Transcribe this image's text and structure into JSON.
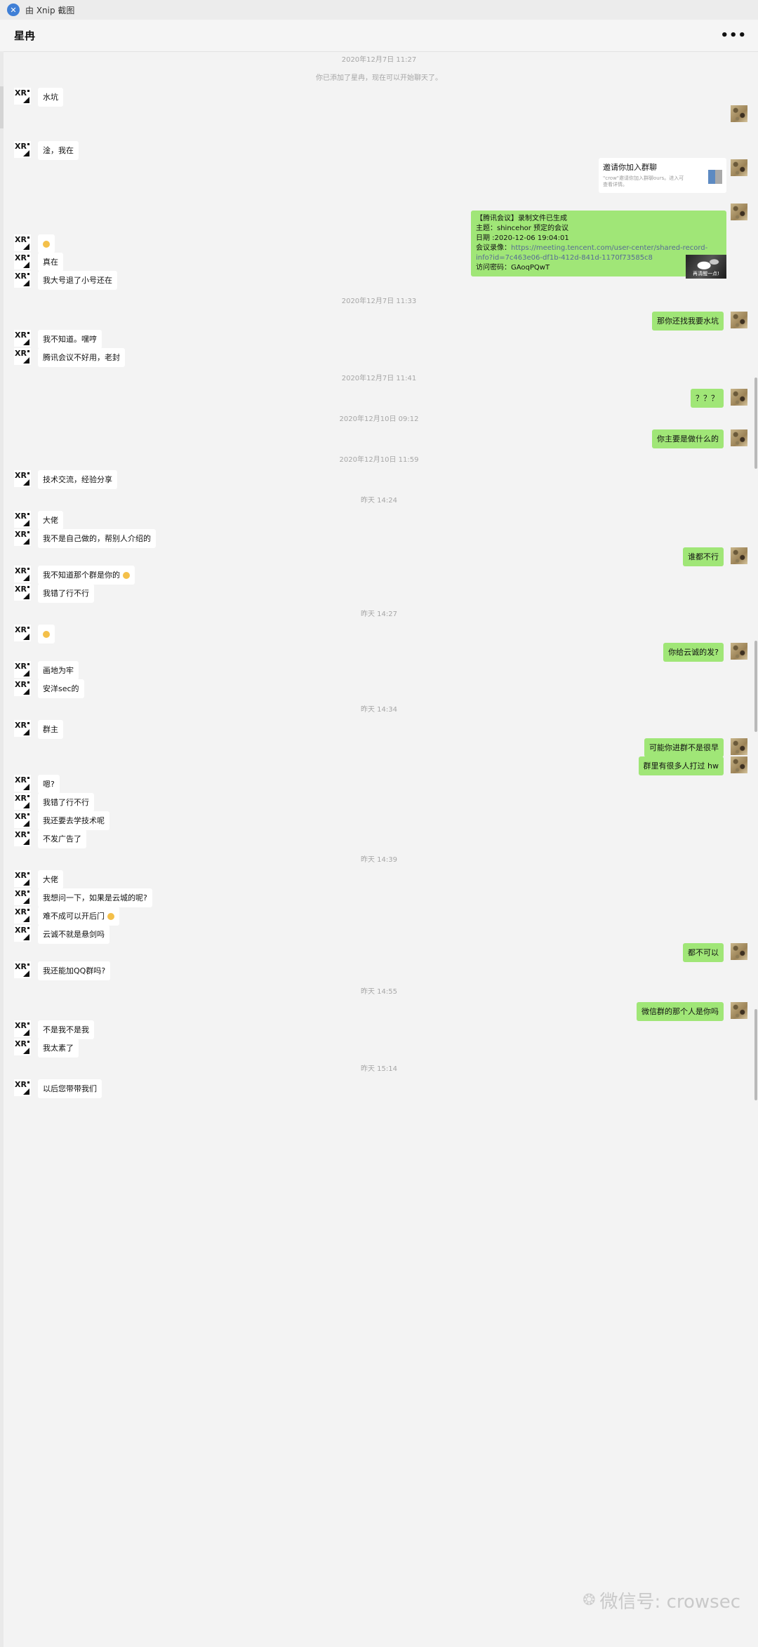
{
  "window": {
    "title": "由 Xnip 截图"
  },
  "chat": {
    "name": "星冉",
    "system_notice": "你已添加了星冉，现在可以开始聊天了。",
    "timestamps": [
      "2020年12月7日 11:27",
      "2020年12月7日 11:33",
      "2020年12月7日 11:41",
      "2020年12月10日 09:12",
      "2020年12月10日 11:59",
      "昨天 14:24",
      "昨天 14:27",
      "昨天 14:34",
      "昨天 14:39",
      "昨天 14:55",
      "昨天 15:14"
    ],
    "contact_avatar_text": "XR",
    "invite_card": {
      "title": "邀请你加入群聊",
      "desc": "\"crow\"邀请你加入群聊ours。进入可查看详情。"
    },
    "meeting": {
      "line1": "【腾讯会议】录制文件已生成",
      "line2": "主题：shincehor 预定的会议",
      "line3": "日期 :2020-12-06 19:04:01",
      "line4_label": "会议录像：",
      "line4_link": "https://meeting.tencent.com/user-center/shared-record-info?id=7c463e06-df1b-412d-841d-1170f73585c8",
      "line5": "访问密码：GAoqPQwT"
    },
    "photo_caption": "再清醒一点!",
    "messages": {
      "m1": "水坑",
      "m2": "淦，我在",
      "m3": "真在",
      "m4": "我大号退了小号还在",
      "m5": "那你还找我要水坑",
      "m6": "我不知道。嘿哼",
      "m7": "腾讯会议不好用，老封",
      "m8": "？？？",
      "m9": "你主要是做什么的",
      "m10": "技术交流，经验分享",
      "m11": "大佬",
      "m12": "我不是自己做的，帮别人介绍的",
      "m13": "谁都不行",
      "m14": "我不知道那个群是你的",
      "m15": "我错了行不行",
      "m16": "你给云诚的发?",
      "m17": "画地为牢",
      "m18": "安洋sec的",
      "m19": "群主",
      "m20": "可能你进群不是很早",
      "m21": "群里有很多人打过 hw",
      "m22": "嗯?",
      "m23": "我错了行不行",
      "m24": "我还要去学技术呢",
      "m25": "不发广告了",
      "m26": "大佬",
      "m27": "我想问一下，如果是云城的呢?",
      "m28": "难不成可以开后门",
      "m29": "云诚不就是悬剑吗",
      "m30": "都不可以",
      "m31": "我还能加QQ群吗?",
      "m32": "微信群的那个人是你吗",
      "m33": "不是我不是我",
      "m34": "我太素了",
      "m35": "以后您带带我们"
    }
  },
  "watermark": {
    "text": "微信号: crowsec"
  }
}
